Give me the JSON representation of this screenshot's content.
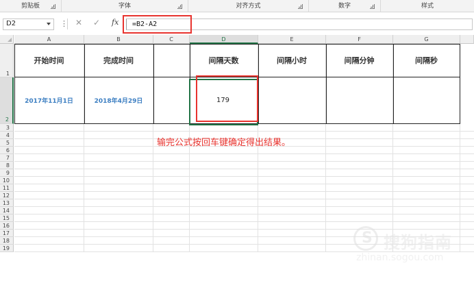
{
  "ribbon": {
    "groups": [
      {
        "label": "剪贴板"
      },
      {
        "label": "字体"
      },
      {
        "label": "对齐方式"
      },
      {
        "label": "数字"
      },
      {
        "label": "样式"
      }
    ]
  },
  "formula_bar": {
    "name_box": "D2",
    "formula": "=B2-A2",
    "cancel_symbol": "✕",
    "enter_symbol": "✓",
    "fx_symbol": "fx"
  },
  "columns": [
    "A",
    "B",
    "C",
    "D",
    "E",
    "F",
    "G"
  ],
  "rows": [
    "1",
    "2",
    "3",
    "4",
    "5",
    "6",
    "7",
    "8",
    "9",
    "10",
    "11",
    "12",
    "13",
    "14",
    "15",
    "16",
    "17",
    "18",
    "19"
  ],
  "table": {
    "headers": [
      "开始时间",
      "完成时间",
      "",
      "间隔天数",
      "间隔小时",
      "间隔分钟",
      "间隔秒"
    ],
    "row2": [
      "2017年11月1日",
      "2018年4月29日",
      "",
      "179",
      "",
      "",
      ""
    ]
  },
  "annotation": "输完公式按回车键确定得出结果。",
  "watermark": {
    "name": "搜狗指南",
    "url": "zhinan.sogou.com"
  },
  "colors": {
    "accent_red": "#e8332e",
    "excel_green": "#217346",
    "date_blue": "#3d7fc2"
  }
}
